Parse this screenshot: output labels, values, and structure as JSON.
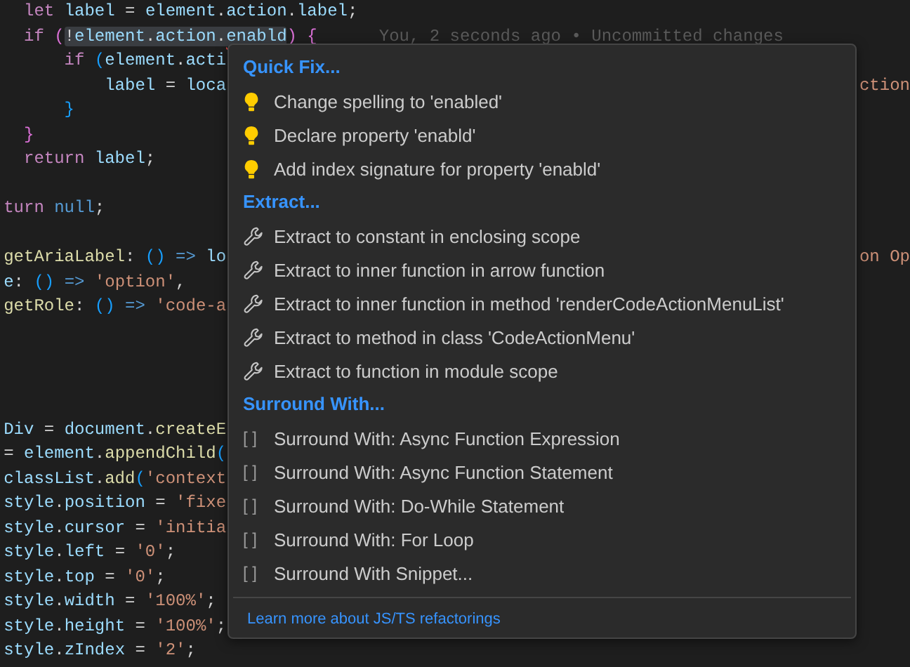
{
  "editor": {
    "lines": [
      {
        "tokens": [
          {
            "kind": "keyword",
            "text": "  let "
          },
          {
            "kind": "variable",
            "text": "label"
          },
          {
            "kind": "plain",
            "text": " = "
          },
          {
            "kind": "variable",
            "text": "element"
          },
          {
            "kind": "plain",
            "text": "."
          },
          {
            "kind": "variable",
            "text": "action"
          },
          {
            "kind": "plain",
            "text": "."
          },
          {
            "kind": "variable",
            "text": "label"
          },
          {
            "kind": "plain",
            "text": ";"
          }
        ]
      },
      {
        "tokens": [
          {
            "kind": "keyword",
            "text": "  if "
          },
          {
            "kind": "bracket1",
            "text": "("
          },
          {
            "kind": "selection",
            "tokens": [
              {
                "kind": "plain",
                "text": "!"
              },
              {
                "kind": "variable",
                "text": "element"
              },
              {
                "kind": "plain",
                "text": "."
              },
              {
                "kind": "variable",
                "text": "action"
              },
              {
                "kind": "plain",
                "text": "."
              },
              {
                "kind": "error",
                "text": "enabld"
              }
            ]
          },
          {
            "kind": "bracket1",
            "text": ") {"
          }
        ],
        "blame": "You, 2 seconds ago • Uncommitted changes"
      },
      {
        "tokens": [
          {
            "kind": "keyword",
            "text": "      if "
          },
          {
            "kind": "bracket2",
            "text": "("
          },
          {
            "kind": "variable",
            "text": "element"
          },
          {
            "kind": "plain",
            "text": "."
          },
          {
            "kind": "variable",
            "text": "acti"
          }
        ]
      },
      {
        "tokens": [
          {
            "kind": "variable",
            "text": "          label"
          },
          {
            "kind": "plain",
            "text": " = "
          },
          {
            "kind": "variable",
            "text": "loca"
          }
        ],
        "fragment": "ction"
      },
      {
        "tokens": [
          {
            "kind": "bracket2",
            "text": "      }"
          }
        ]
      },
      {
        "tokens": [
          {
            "kind": "bracket1",
            "text": "  }"
          }
        ]
      },
      {
        "tokens": [
          {
            "kind": "keyword",
            "text": "  return "
          },
          {
            "kind": "variable",
            "text": "label"
          },
          {
            "kind": "plain",
            "text": ";"
          }
        ]
      },
      {
        "kind": "blank"
      },
      {
        "tokens": [
          {
            "kind": "keyword",
            "text": "turn "
          },
          {
            "kind": "constant",
            "text": "null"
          },
          {
            "kind": "plain",
            "text": ";"
          }
        ]
      },
      {
        "kind": "blank"
      },
      {
        "tokens": [
          {
            "kind": "function",
            "text": "getAriaLabel"
          },
          {
            "kind": "plain",
            "text": ": "
          },
          {
            "kind": "bracket2",
            "text": "() "
          },
          {
            "kind": "constant",
            "text": "=> "
          },
          {
            "kind": "variable",
            "text": "lo"
          }
        ],
        "fragment": "on Op"
      },
      {
        "tokens": [
          {
            "kind": "variable",
            "text": "e"
          },
          {
            "kind": "plain",
            "text": ": "
          },
          {
            "kind": "bracket2",
            "text": "() "
          },
          {
            "kind": "constant",
            "text": "=> "
          },
          {
            "kind": "string",
            "text": "'option'"
          },
          {
            "kind": "plain",
            "text": ","
          }
        ]
      },
      {
        "tokens": [
          {
            "kind": "function",
            "text": "getRole"
          },
          {
            "kind": "plain",
            "text": ": "
          },
          {
            "kind": "bracket2",
            "text": "() "
          },
          {
            "kind": "constant",
            "text": "=> "
          },
          {
            "kind": "string",
            "text": "'code-a"
          }
        ]
      },
      {
        "kind": "blank"
      },
      {
        "kind": "blank"
      },
      {
        "kind": "blank"
      },
      {
        "kind": "blank"
      },
      {
        "tokens": [
          {
            "kind": "variable",
            "text": "Div"
          },
          {
            "kind": "plain",
            "text": " = "
          },
          {
            "kind": "variable",
            "text": "document"
          },
          {
            "kind": "plain",
            "text": "."
          },
          {
            "kind": "function",
            "text": "createE"
          }
        ]
      },
      {
        "tokens": [
          {
            "kind": "plain",
            "text": "= "
          },
          {
            "kind": "variable",
            "text": "element"
          },
          {
            "kind": "plain",
            "text": "."
          },
          {
            "kind": "function",
            "text": "appendChild"
          },
          {
            "kind": "bracket2",
            "text": "("
          }
        ]
      },
      {
        "tokens": [
          {
            "kind": "variable",
            "text": "classList"
          },
          {
            "kind": "plain",
            "text": "."
          },
          {
            "kind": "function",
            "text": "add"
          },
          {
            "kind": "bracket2",
            "text": "("
          },
          {
            "kind": "string",
            "text": "'context"
          }
        ]
      },
      {
        "tokens": [
          {
            "kind": "variable",
            "text": "style"
          },
          {
            "kind": "plain",
            "text": "."
          },
          {
            "kind": "variable",
            "text": "position"
          },
          {
            "kind": "plain",
            "text": " = "
          },
          {
            "kind": "string",
            "text": "'fixe"
          }
        ]
      },
      {
        "tokens": [
          {
            "kind": "variable",
            "text": "style"
          },
          {
            "kind": "plain",
            "text": "."
          },
          {
            "kind": "variable",
            "text": "cursor"
          },
          {
            "kind": "plain",
            "text": " = "
          },
          {
            "kind": "string",
            "text": "'initia"
          }
        ]
      },
      {
        "tokens": [
          {
            "kind": "variable",
            "text": "style"
          },
          {
            "kind": "plain",
            "text": "."
          },
          {
            "kind": "variable",
            "text": "left"
          },
          {
            "kind": "plain",
            "text": " = "
          },
          {
            "kind": "string",
            "text": "'0'"
          },
          {
            "kind": "plain",
            "text": ";"
          }
        ]
      },
      {
        "tokens": [
          {
            "kind": "variable",
            "text": "style"
          },
          {
            "kind": "plain",
            "text": "."
          },
          {
            "kind": "variable",
            "text": "top"
          },
          {
            "kind": "plain",
            "text": " = "
          },
          {
            "kind": "string",
            "text": "'0'"
          },
          {
            "kind": "plain",
            "text": ";"
          }
        ]
      },
      {
        "tokens": [
          {
            "kind": "variable",
            "text": "style"
          },
          {
            "kind": "plain",
            "text": "."
          },
          {
            "kind": "variable",
            "text": "width"
          },
          {
            "kind": "plain",
            "text": " = "
          },
          {
            "kind": "string",
            "text": "'100%'"
          },
          {
            "kind": "plain",
            "text": ";"
          }
        ]
      },
      {
        "tokens": [
          {
            "kind": "variable",
            "text": "style"
          },
          {
            "kind": "plain",
            "text": "."
          },
          {
            "kind": "variable",
            "text": "height"
          },
          {
            "kind": "plain",
            "text": " = "
          },
          {
            "kind": "string",
            "text": "'100%'"
          },
          {
            "kind": "plain",
            "text": ";"
          }
        ]
      },
      {
        "tokens": [
          {
            "kind": "variable",
            "text": "style"
          },
          {
            "kind": "plain",
            "text": "."
          },
          {
            "kind": "variable",
            "text": "zIndex"
          },
          {
            "kind": "plain",
            "text": " = "
          },
          {
            "kind": "string",
            "text": "'2'"
          },
          {
            "kind": "plain",
            "text": ";"
          }
        ]
      }
    ]
  },
  "code_action_menu": {
    "sections": [
      {
        "title": "Quick Fix...",
        "kind": "quickfix",
        "items": [
          {
            "label": "Change spelling to 'enabled'"
          },
          {
            "label": "Declare property 'enabld'"
          },
          {
            "label": "Add index signature for property 'enabld'"
          }
        ]
      },
      {
        "title": "Extract...",
        "kind": "refactor",
        "items": [
          {
            "label": "Extract to constant in enclosing scope"
          },
          {
            "label": "Extract to inner function in arrow function"
          },
          {
            "label": "Extract to inner function in method 'renderCodeActionMenuList'"
          },
          {
            "label": "Extract to method in class 'CodeActionMenu'"
          },
          {
            "label": "Extract to function in module scope"
          }
        ]
      },
      {
        "title": "Surround With...",
        "kind": "surround",
        "items": [
          {
            "glyph": "[ ]",
            "label": "Surround With: Async Function Expression"
          },
          {
            "glyph": "[ ]",
            "label": "Surround With: Async Function Statement"
          },
          {
            "glyph": "[ ]",
            "label": "Surround With: Do-While Statement"
          },
          {
            "glyph": "[ ]",
            "label": "Surround With: For Loop"
          },
          {
            "glyph": "[ ]",
            "label": "Surround With Snippet..."
          }
        ]
      }
    ],
    "footer_link": "Learn more about JS/TS refactorings"
  }
}
